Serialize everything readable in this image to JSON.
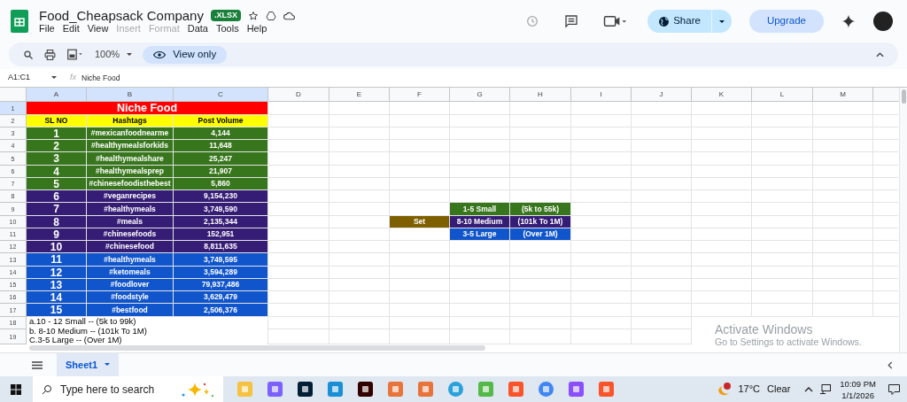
{
  "doc": {
    "title": "Food_Cheapsack Company",
    "badge": ".XLSX",
    "menu": [
      {
        "label": "File",
        "disabled": false
      },
      {
        "label": "Edit",
        "disabled": false
      },
      {
        "label": "View",
        "disabled": false
      },
      {
        "label": "Insert",
        "disabled": true
      },
      {
        "label": "Format",
        "disabled": true
      },
      {
        "label": "Data",
        "disabled": false
      },
      {
        "label": "Tools",
        "disabled": false
      },
      {
        "label": "Help",
        "disabled": false
      }
    ],
    "share": "Share",
    "upgrade": "Upgrade"
  },
  "toolbar": {
    "zoom": "100%",
    "mode": "View only"
  },
  "formula_bar": {
    "name_box": "A1:C1",
    "fx": "fx",
    "formula": "Niche Food"
  },
  "sheet": {
    "columns": [
      "A",
      "B",
      "C",
      "D",
      "E",
      "F",
      "G",
      "H",
      "I",
      "J",
      "K",
      "L",
      "M"
    ],
    "row_numbers": [
      "1",
      "2",
      "3",
      "4",
      "5",
      "6",
      "7",
      "8",
      "9",
      "10",
      "11",
      "12",
      "13",
      "14",
      "15",
      "16",
      "17",
      "18",
      "19"
    ],
    "title": "Niche Food",
    "headers": [
      "SL NO",
      "Hashtags",
      "Post Volume"
    ],
    "groups": [
      {
        "color": "#38761d",
        "rows": [
          {
            "sl": "1",
            "hashtag": "#mexicanfoodnearme",
            "volume": "4,144"
          },
          {
            "sl": "2",
            "hashtag": "#healthymealsforkids",
            "volume": "11,648"
          },
          {
            "sl": "3",
            "hashtag": "#healthymealshare",
            "volume": "25,247"
          },
          {
            "sl": "4",
            "hashtag": "#healthymealsprep",
            "volume": "21,907"
          },
          {
            "sl": "5",
            "hashtag": "#chinesefoodisthebest",
            "volume": "5,860"
          }
        ]
      },
      {
        "color": "#351c75",
        "rows": [
          {
            "sl": "6",
            "hashtag": "#veganrecipes",
            "volume": "9,154,230"
          },
          {
            "sl": "7",
            "hashtag": "#healthymeals",
            "volume": "3,749,590"
          },
          {
            "sl": "8",
            "hashtag": "#meals",
            "volume": "2,135,344"
          },
          {
            "sl": "9",
            "hashtag": "#chinesefoods",
            "volume": "152,951"
          },
          {
            "sl": "10",
            "hashtag": "#chinesefood",
            "volume": "8,811,635"
          }
        ]
      },
      {
        "color": "#1155cc",
        "rows": [
          {
            "sl": "11",
            "hashtag": "#healthymeals",
            "volume": "3,749,595"
          },
          {
            "sl": "12",
            "hashtag": "#ketomeals",
            "volume": "3,594,289"
          },
          {
            "sl": "13",
            "hashtag": "#foodlover",
            "volume": "79,937,486"
          },
          {
            "sl": "14",
            "hashtag": "#foodstyle",
            "volume": "3,629,479"
          },
          {
            "sl": "15",
            "hashtag": "#bestfood",
            "volume": "2,506,376"
          }
        ]
      }
    ],
    "notes": [
      "a.10 - 12 Small -- (5k to 99k)",
      "b. 8-10 Medium -- (101k To 1M)",
      "C.3-5 Large -- (Over 1M)"
    ],
    "legend": {
      "set_label": "Set",
      "rows": [
        {
          "size": "1-5 Small",
          "range": "(5k to 55k)",
          "color": "#38761d"
        },
        {
          "size": "8-10 Medium",
          "range": "(101k To 1M)",
          "color": "#351c75"
        },
        {
          "size": "3-5 Large",
          "range": "(Over 1M)",
          "color": "#1155cc"
        }
      ]
    }
  },
  "tabs": [
    {
      "label": "Sheet1",
      "selected": true
    }
  ],
  "activation": [
    "Activate Windows",
    "Go to Settings to activate Windows."
  ],
  "taskbar": {
    "search_placeholder": "Type here to search",
    "temperature": "17°C",
    "weather": "Clear",
    "time": "10:09 PM",
    "date": "1/1/2026"
  }
}
